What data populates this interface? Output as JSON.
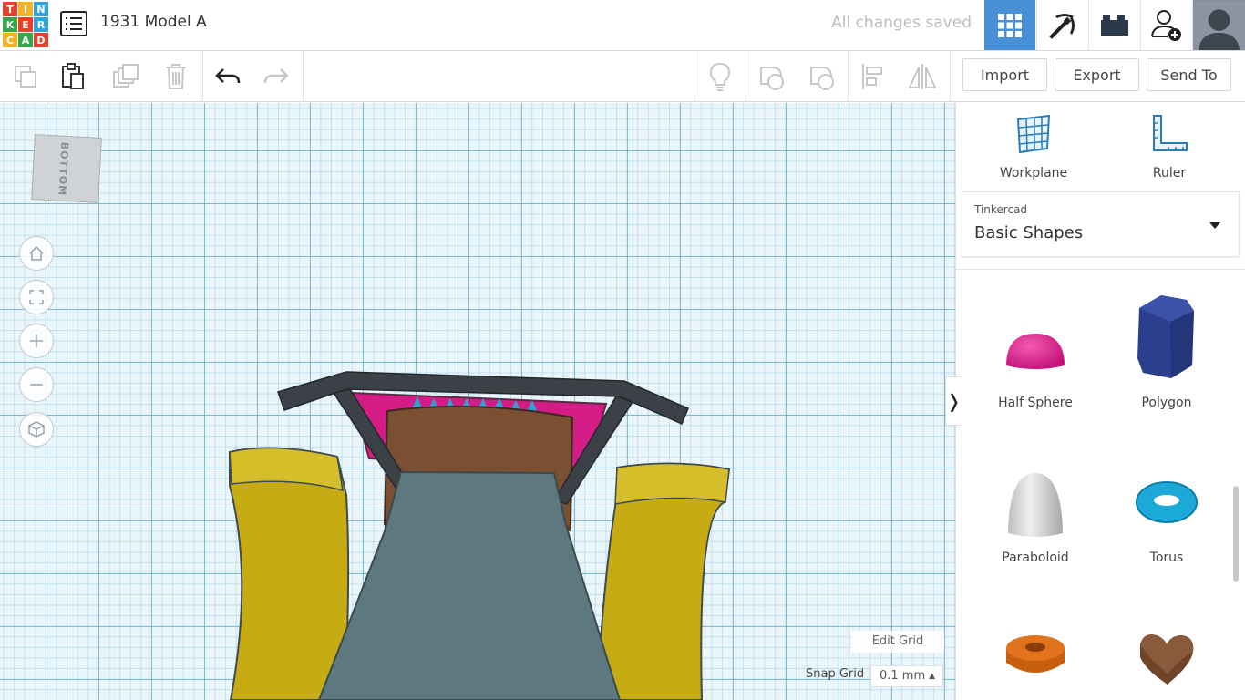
{
  "app": {
    "logo_letters": [
      "T",
      "I",
      "N",
      "K",
      "E",
      "R",
      "C",
      "A",
      "D"
    ],
    "logo_colors": [
      "#e8402d",
      "#f4b322",
      "#2ea4d9",
      "#35a64a",
      "#e8402d",
      "#2ea4d9",
      "#f4b322",
      "#35a64a",
      "#e8402d"
    ],
    "design_title": "1931 Model A",
    "save_status": "All changes saved",
    "accent_color": "#4a90d9"
  },
  "toolbar": {
    "import_label": "Import",
    "export_label": "Export",
    "send_to_label": "Send To",
    "icons": [
      "copy-icon",
      "paste-icon",
      "duplicate-icon",
      "delete-icon",
      "undo-icon",
      "redo-icon",
      "light-bulb-icon",
      "solid-icon",
      "hole-icon",
      "align-icon",
      "mirror-icon"
    ]
  },
  "workplane": {
    "view_cube_label": "BOTTOM",
    "nav_icons": [
      "home-icon",
      "fit-view-icon",
      "zoom-in-icon",
      "zoom-out-icon",
      "perspective-icon"
    ],
    "edit_grid_label": "Edit Grid",
    "snap_grid_label": "Snap Grid",
    "snap_grid_value": "0.1 mm",
    "model_colors": {
      "frame": "#3b4147",
      "body": "#5e7880",
      "fender": "#c6ab12",
      "seat": "#7b4f32",
      "accent": "#d41c87",
      "spikes": "#2ca3cf"
    }
  },
  "panel": {
    "workplane_label": "Workplane",
    "ruler_label": "Ruler",
    "library_source": "Tinkercad",
    "library_name": "Basic Shapes",
    "shapes": [
      {
        "label": "Half Sphere",
        "color": "#e21c8d"
      },
      {
        "label": "Polygon",
        "color": "#2c3f8f"
      },
      {
        "label": "Paraboloid",
        "color": "#dcdcdc"
      },
      {
        "label": "Torus",
        "color": "#1ba9d8"
      },
      {
        "label": "",
        "color": "#e2721c"
      },
      {
        "label": "",
        "color": "#8a5a3c"
      }
    ]
  }
}
